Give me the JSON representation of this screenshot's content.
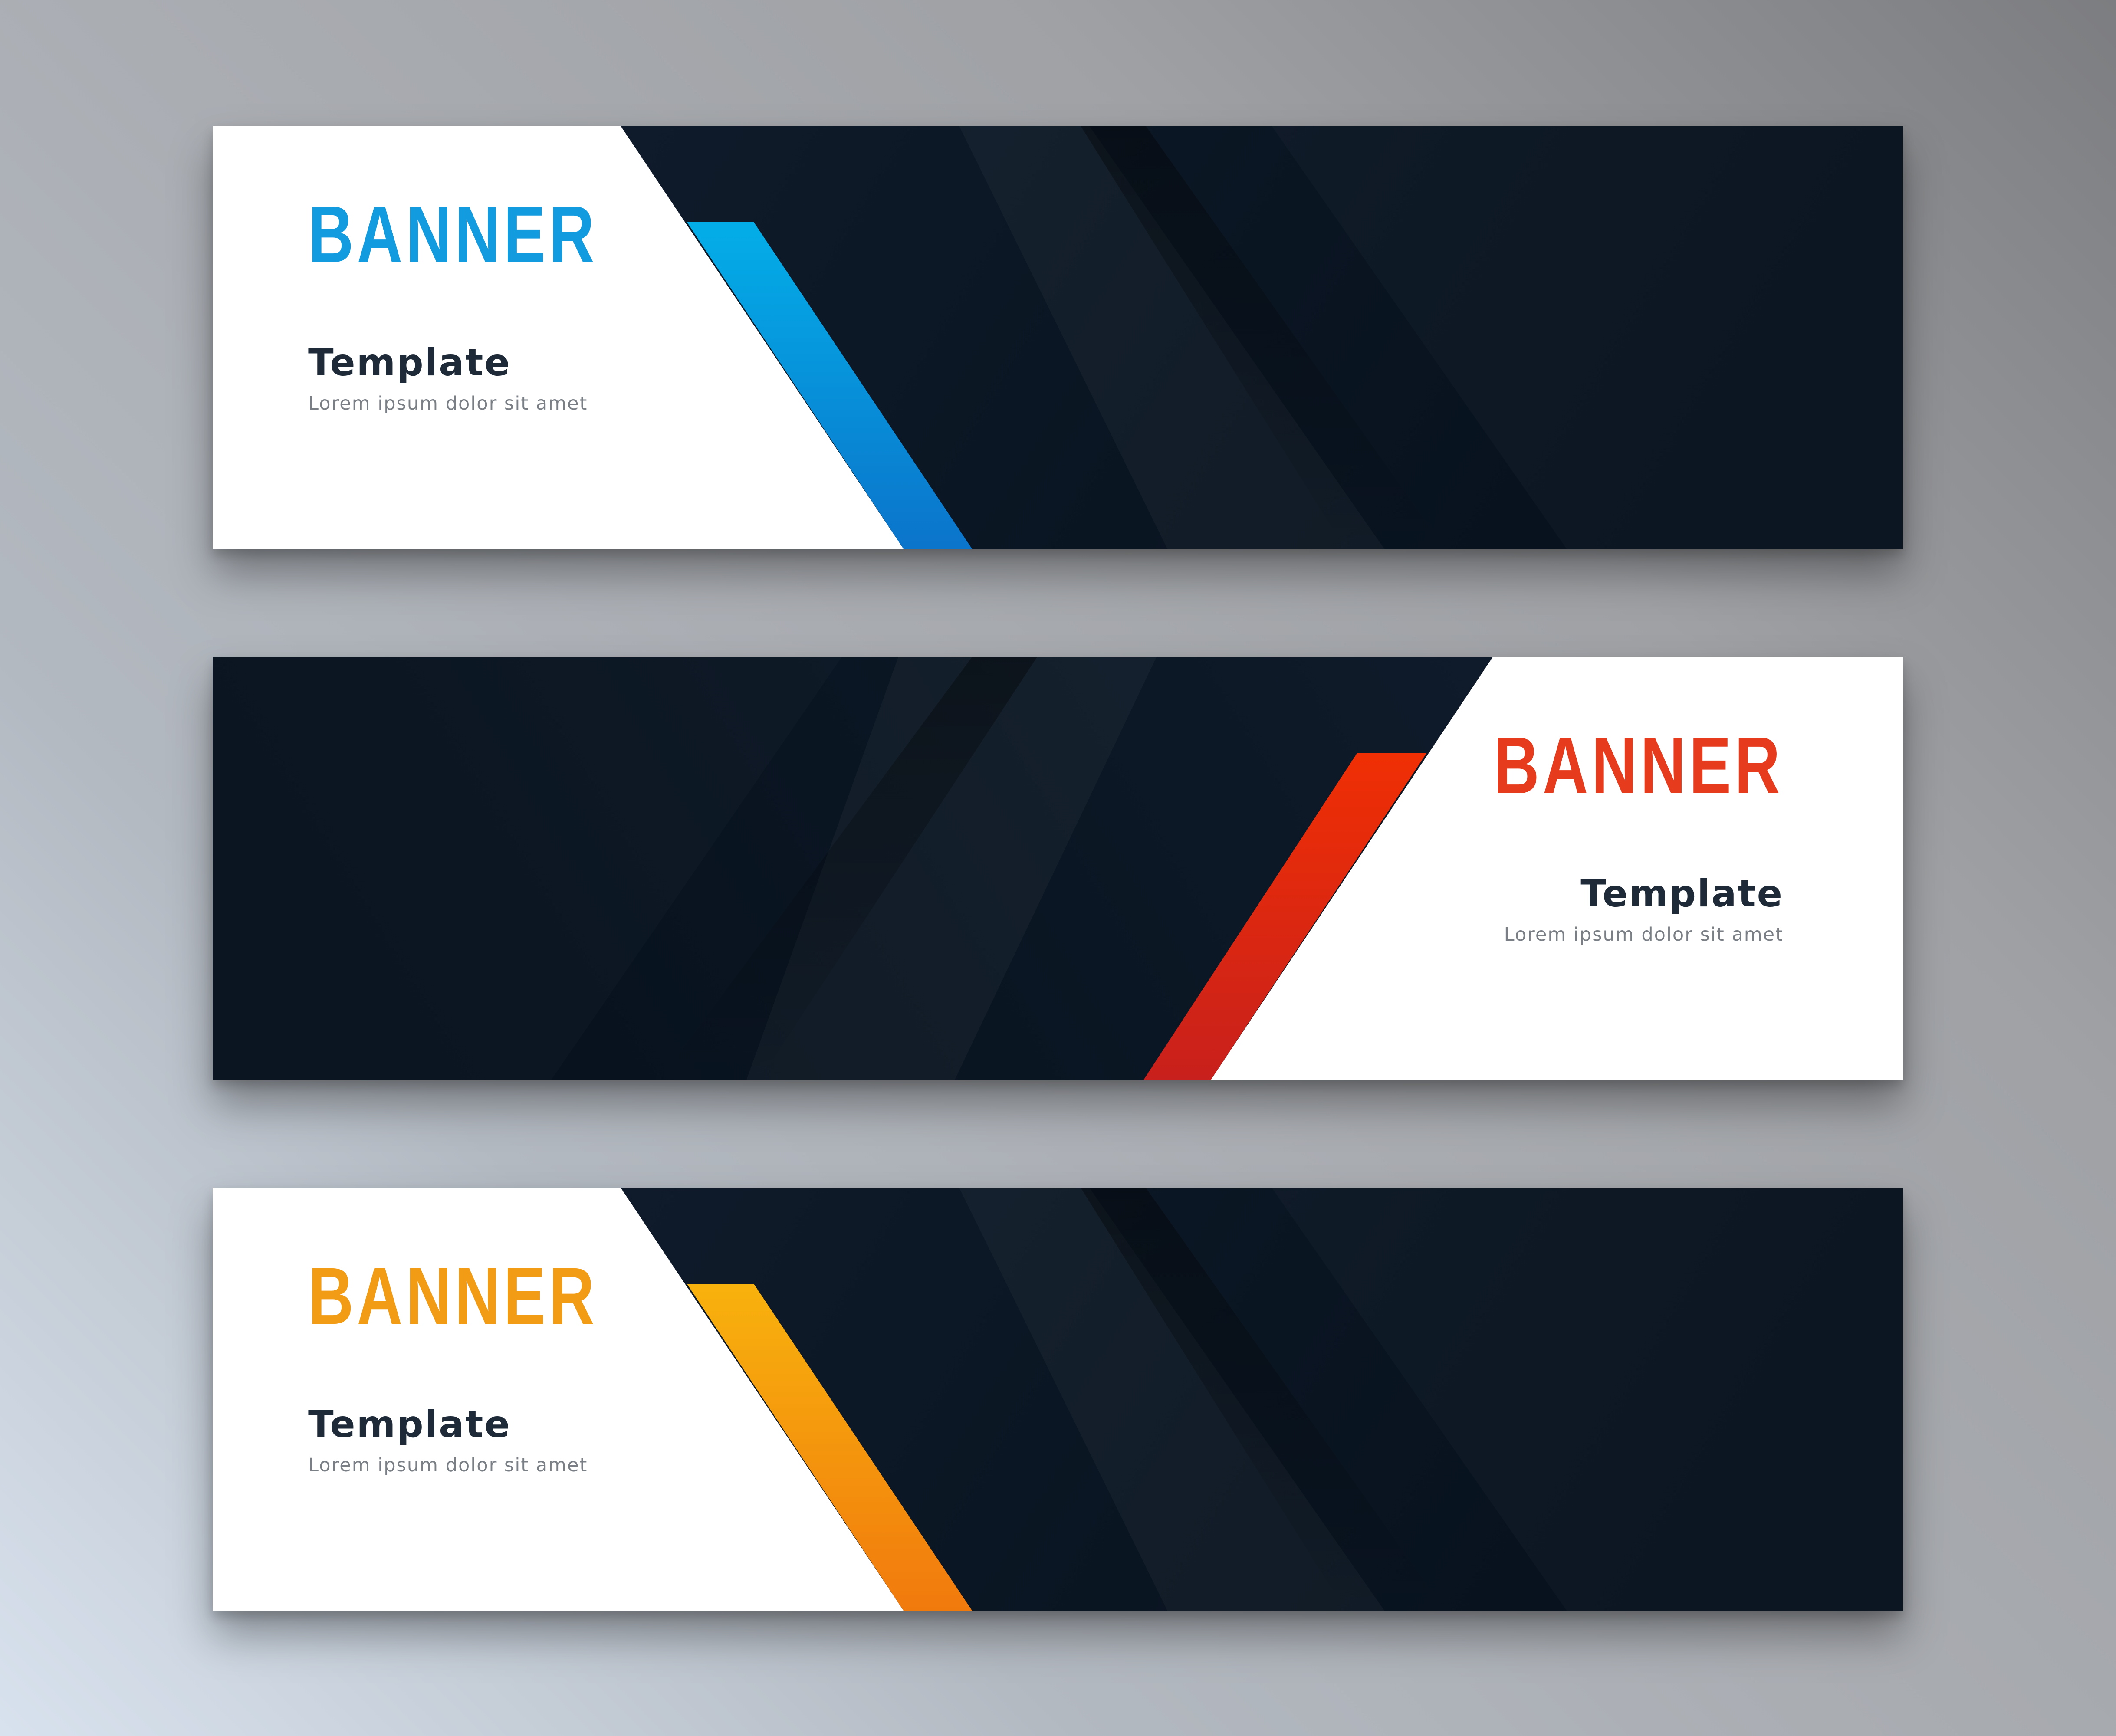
{
  "colors": {
    "blue_accent": "#139be0",
    "red_accent": "#e63b1d",
    "orange_accent": "#f29b14",
    "dark_panel": "#0b1522",
    "text_dark": "#1e2a38",
    "caption_gray": "#7a7f86"
  },
  "banners": [
    {
      "heading": "BANNER",
      "subheading": "Template",
      "caption": "Lorem ipsum dolor sit amet",
      "accent": "blue",
      "text_side": "left"
    },
    {
      "heading": "BANNER",
      "subheading": "Template",
      "caption": "Lorem ipsum dolor sit amet",
      "accent": "red",
      "text_side": "right"
    },
    {
      "heading": "BANNER",
      "subheading": "Template",
      "caption": "Lorem ipsum dolor sit amet",
      "accent": "orange",
      "text_side": "left"
    }
  ]
}
